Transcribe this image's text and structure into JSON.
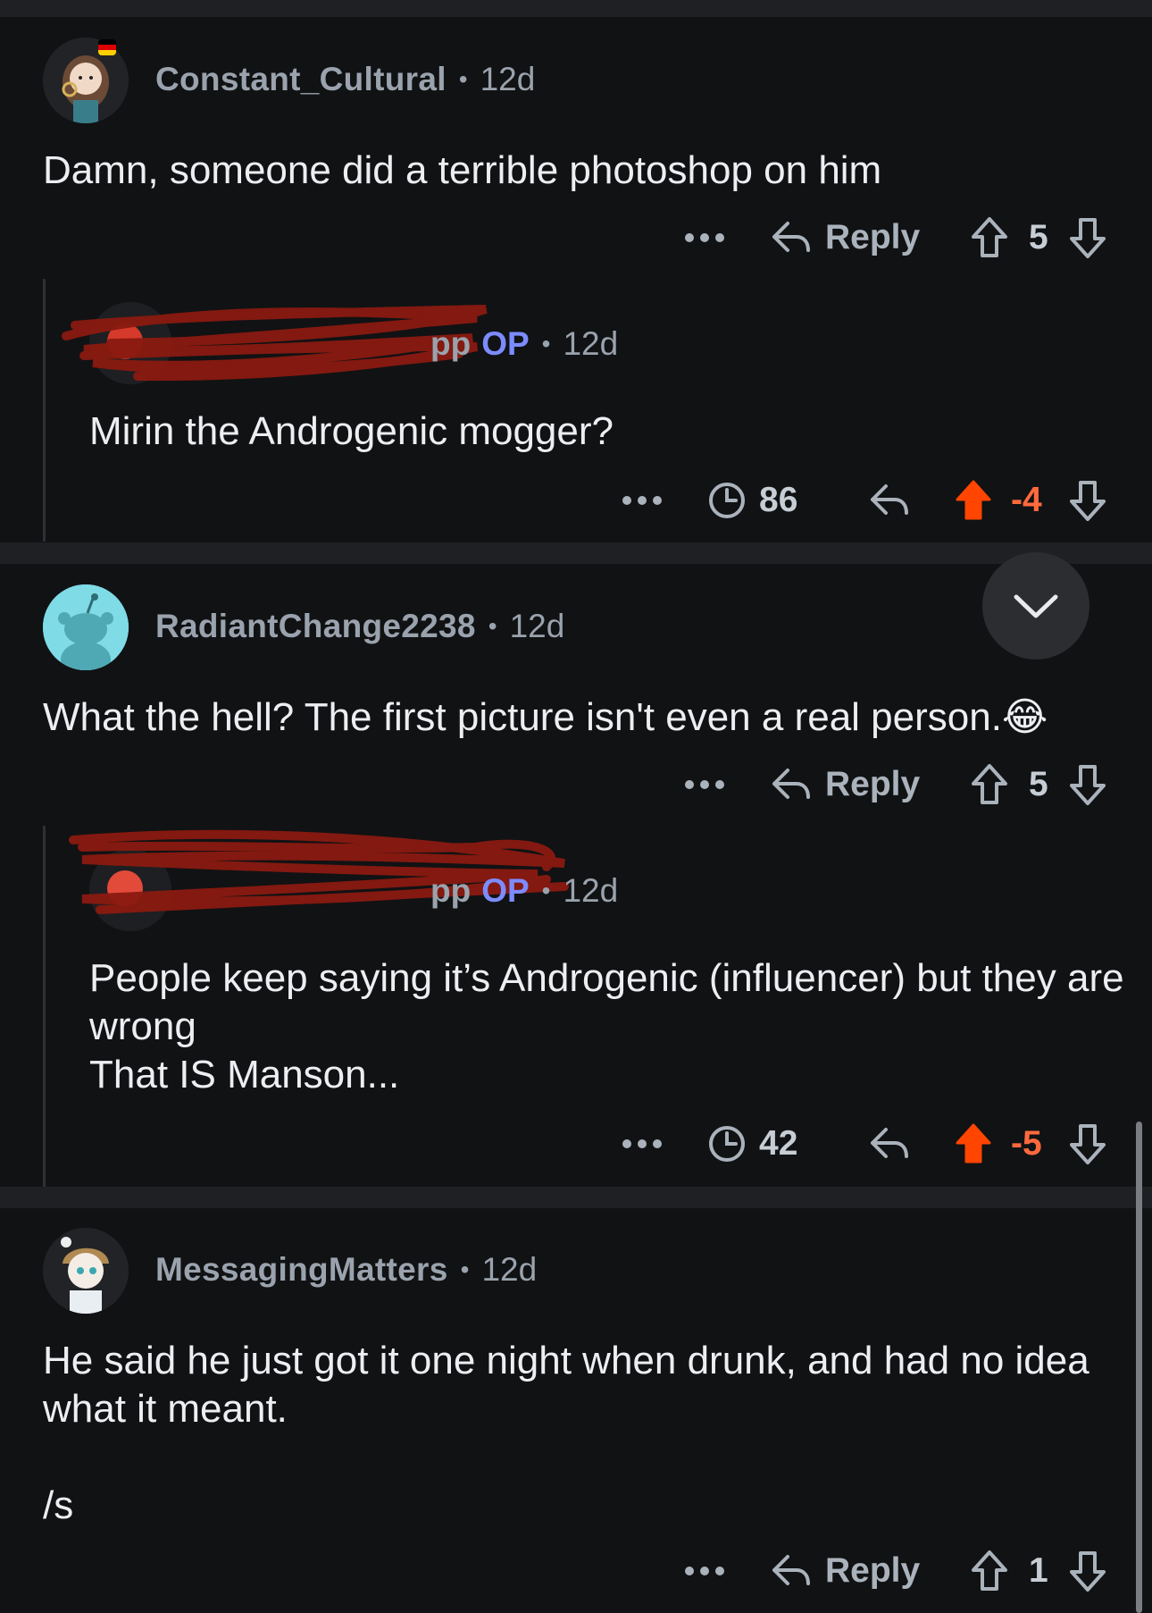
{
  "comments": [
    {
      "username": "Constant_Cultural",
      "separator": "•",
      "age": "12d",
      "text": "Damn, someone did a terrible photoshop on him",
      "more_icon": "ellipsis-icon",
      "reply_label": "Reply",
      "score": "5",
      "reply": {
        "username_fragment": "pp",
        "op_badge": "OP",
        "age": "12d",
        "text": "Mirin the Androgenic mogger?",
        "awards_count": "86",
        "score": "-4"
      }
    },
    {
      "username": "RadiantChange2238",
      "separator": "•",
      "age": "12d",
      "text": "What the hell? The first picture isn't even a real person.😂",
      "reply_label": "Reply",
      "score": "5",
      "reply": {
        "username_fragment": "pp",
        "op_badge": "OP",
        "age": "12d",
        "text": "People keep saying it’s Androgenic (influencer) but they are wrong\nThat IS Manson...",
        "awards_count": "42",
        "score": "-5"
      }
    },
    {
      "username": "MessagingMatters",
      "separator": "•",
      "age": "12d",
      "text": "He said he just got it one night when drunk, and had no idea what it meant.\n\n/s",
      "reply_label": "Reply",
      "score": "1"
    }
  ],
  "colors": {
    "background": "#111214",
    "separator": "#1f2023",
    "upvote_active": "#ff4500",
    "op_badge": "#7c8cff",
    "redaction": "#8a1a10"
  }
}
